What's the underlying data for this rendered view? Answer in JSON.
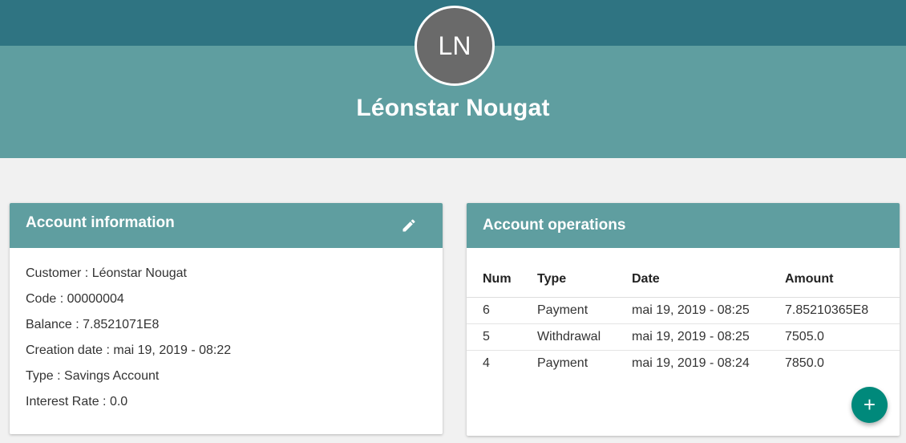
{
  "profile": {
    "initials": "LN",
    "name": "Léonstar Nougat"
  },
  "account_info": {
    "title": "Account information",
    "edit_icon": "edit-pencil-icon",
    "lines": [
      "Customer : Léonstar Nougat",
      "Code : 00000004",
      "Balance : 7.8521071E8",
      "Creation date : mai 19, 2019 - 08:22",
      "Type : Savings Account",
      "Interest Rate : 0.0"
    ]
  },
  "operations": {
    "title": "Account operations",
    "columns": [
      "Num",
      "Type",
      "Date",
      "Amount"
    ],
    "rows": [
      [
        "6",
        "Payment",
        "mai 19, 2019 - 08:25",
        "7.85210365E8"
      ],
      [
        "5",
        "Withdrawal",
        "mai 19, 2019 - 08:25",
        "7505.0"
      ],
      [
        "4",
        "Payment",
        "mai 19, 2019 - 08:24",
        "7850.0"
      ]
    ]
  },
  "fab": {
    "label": "+",
    "icon": "plus-icon"
  },
  "colors": {
    "topbar": "#2f7482",
    "hero": "#5f9ea0",
    "fab": "#00897b",
    "avatar": "#6a6a6a"
  }
}
